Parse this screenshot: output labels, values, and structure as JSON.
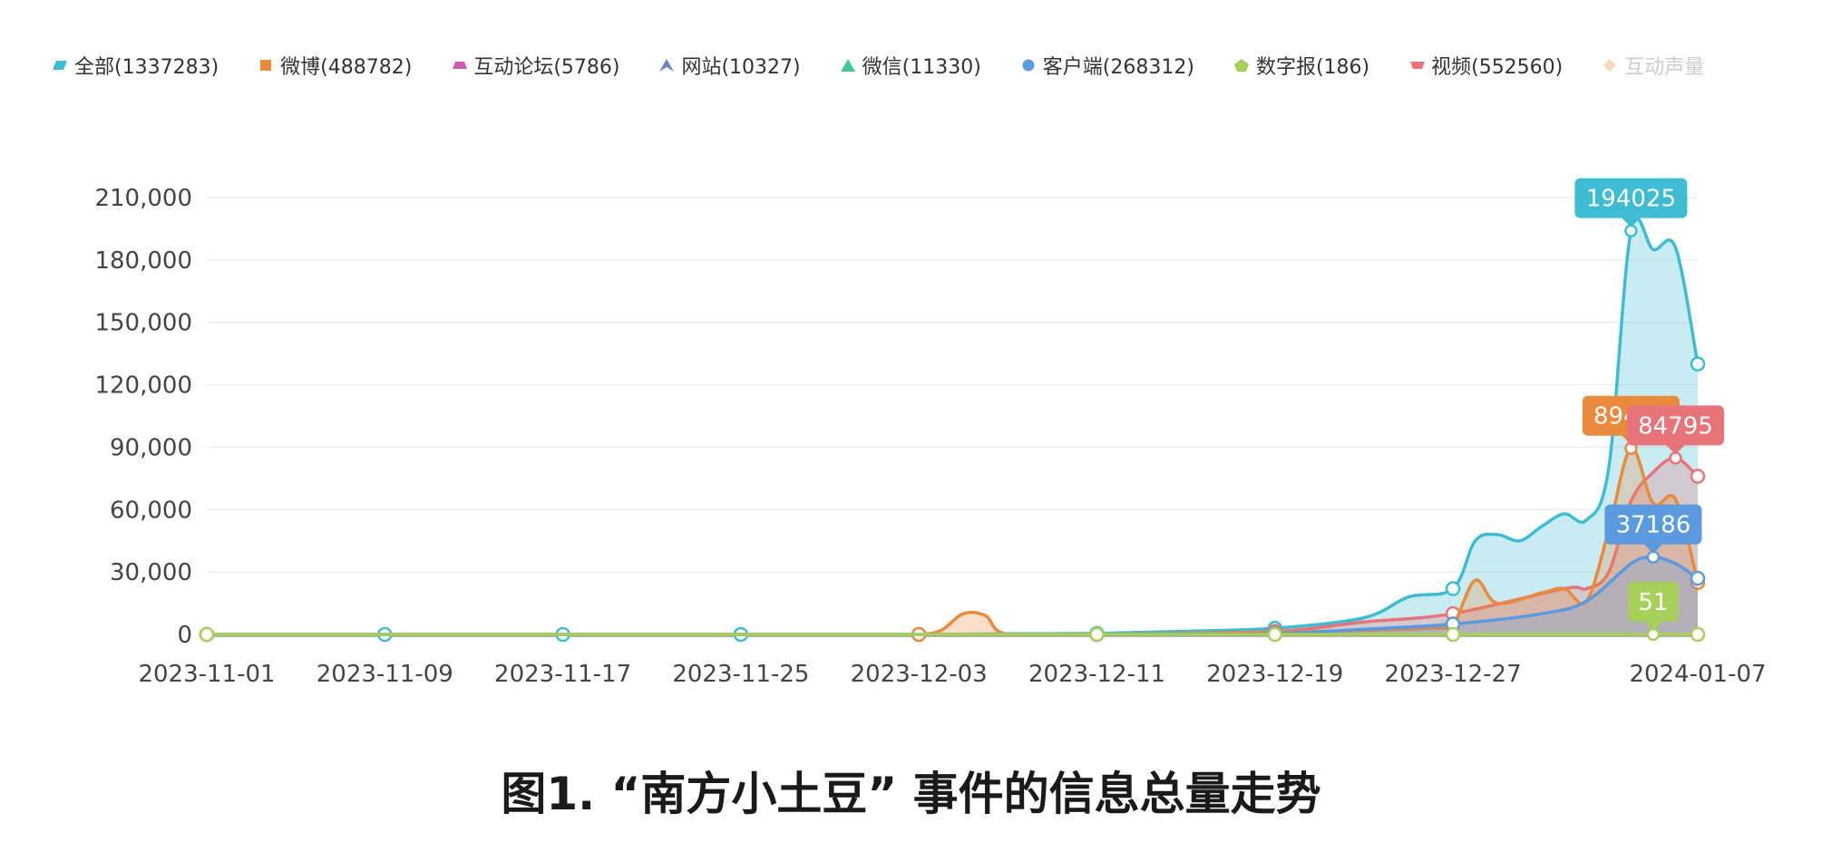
{
  "caption": "图1. “南方小土豆” 事件的信息总量走势",
  "legend": [
    {
      "label": "全部(1337283)",
      "icon": "parallelogram",
      "color": "#3ebcd4",
      "enabled": true
    },
    {
      "label": "微博(488782)",
      "icon": "square",
      "color": "#ea8a3c",
      "enabled": true
    },
    {
      "label": "互动论坛(5786)",
      "icon": "trapezoid",
      "color": "#d05ab0",
      "enabled": true
    },
    {
      "label": "网站(10327)",
      "icon": "arrow",
      "color": "#6d84c4",
      "enabled": true
    },
    {
      "label": "微信(11330)",
      "icon": "triangle",
      "color": "#3ec98e",
      "enabled": true
    },
    {
      "label": "客户端(268312)",
      "icon": "circle",
      "color": "#5b9ade",
      "enabled": true
    },
    {
      "label": "数字报(186)",
      "icon": "pentagon",
      "color": "#a6d05a",
      "enabled": true
    },
    {
      "label": "视频(552560)",
      "icon": "trapezoid-down",
      "color": "#e8747a",
      "enabled": true
    },
    {
      "label": "互动声量",
      "icon": "diamond",
      "color": "#f5d9b8",
      "enabled": false
    }
  ],
  "chart_data": {
    "type": "area",
    "x_tick_labels": [
      "2023-11-01",
      "2023-11-09",
      "2023-11-17",
      "2023-11-25",
      "2023-12-03",
      "2023-12-11",
      "2023-12-19",
      "2023-12-27",
      "2024-01-07"
    ],
    "y_tick_labels": [
      "0",
      "30,000",
      "60,000",
      "90,000",
      "120,000",
      "150,000",
      "180,000",
      "210,000"
    ],
    "ylim": [
      0,
      210000
    ],
    "xlim": [
      "2023-11-01",
      "2024-01-07"
    ],
    "grid": true,
    "legend_position": "top",
    "series": [
      {
        "name": "全部",
        "color": "#3ebcd4",
        "x": [
          "2023-11-01",
          "2023-11-09",
          "2023-11-17",
          "2023-11-25",
          "2023-12-03",
          "2023-12-07",
          "2023-12-11",
          "2023-12-15",
          "2023-12-19",
          "2023-12-23",
          "2023-12-25",
          "2023-12-27",
          "2023-12-28",
          "2023-12-29",
          "2023-12-30",
          "2023-12-31",
          "2024-01-01",
          "2024-01-02",
          "2024-01-03",
          "2024-01-04",
          "2024-01-05",
          "2024-01-06",
          "2024-01-07"
        ],
        "y": [
          0,
          0,
          0,
          0,
          0,
          300,
          500,
          1500,
          3000,
          8000,
          18000,
          22000,
          45000,
          48000,
          45000,
          52000,
          58000,
          55000,
          80000,
          194025,
          185000,
          186000,
          130000
        ]
      },
      {
        "name": "视频",
        "color": "#e8747a",
        "x": [
          "2023-11-01",
          "2023-12-03",
          "2023-12-11",
          "2023-12-19",
          "2023-12-23",
          "2023-12-27",
          "2024-01-01",
          "2024-01-02",
          "2024-01-03",
          "2024-01-04",
          "2024-01-05",
          "2024-01-06",
          "2024-01-07"
        ],
        "y": [
          0,
          0,
          0,
          1500,
          6000,
          10000,
          22000,
          22000,
          30000,
          64000,
          78000,
          84795,
          76000
        ]
      },
      {
        "name": "微博",
        "color": "#ea8a3c",
        "x": [
          "2023-11-01",
          "2023-12-01",
          "2023-12-03",
          "2023-12-04",
          "2023-12-05",
          "2023-12-06",
          "2023-12-07",
          "2023-12-11",
          "2023-12-19",
          "2023-12-26",
          "2023-12-27",
          "2023-12-28",
          "2023-12-29",
          "2023-12-31",
          "2024-01-01",
          "2024-01-02",
          "2024-01-03",
          "2024-01-04",
          "2024-01-05",
          "2024-01-06",
          "2024-01-07"
        ],
        "y": [
          0,
          0,
          0,
          2000,
          10000,
          9000,
          0,
          0,
          1000,
          3000,
          5000,
          26000,
          15000,
          20000,
          22000,
          16000,
          50000,
          89451,
          63000,
          65000,
          25000
        ]
      },
      {
        "name": "客户端",
        "color": "#5b9ade",
        "x": [
          "2023-11-01",
          "2023-12-11",
          "2023-12-19",
          "2023-12-23",
          "2023-12-27",
          "2023-12-31",
          "2024-01-02",
          "2024-01-04",
          "2024-01-05",
          "2024-01-06",
          "2024-01-07"
        ],
        "y": [
          0,
          0,
          500,
          2500,
          5000,
          10000,
          16000,
          34000,
          37186,
          34000,
          27000
        ]
      },
      {
        "name": "数字报",
        "color": "#a6d05a",
        "x": [
          "2023-11-01",
          "2023-12-11",
          "2023-12-19",
          "2023-12-27",
          "2024-01-04",
          "2024-01-05",
          "2024-01-07"
        ],
        "y": [
          0,
          0,
          0,
          0,
          0,
          51,
          0
        ]
      }
    ],
    "annotations": [
      {
        "series": "全部",
        "x": "2024-01-04",
        "value": "194025",
        "color": "#3ebcd4"
      },
      {
        "series": "微博",
        "x": "2024-01-04",
        "value": "89451",
        "color": "#ea8a3c"
      },
      {
        "series": "视频",
        "x": "2024-01-06",
        "value": "84795",
        "color": "#e8747a"
      },
      {
        "series": "客户端",
        "x": "2024-01-05",
        "value": "37186",
        "color": "#5b9ade"
      },
      {
        "series": "数字报",
        "x": "2024-01-05",
        "value": "51",
        "color": "#a6d05a"
      }
    ]
  }
}
